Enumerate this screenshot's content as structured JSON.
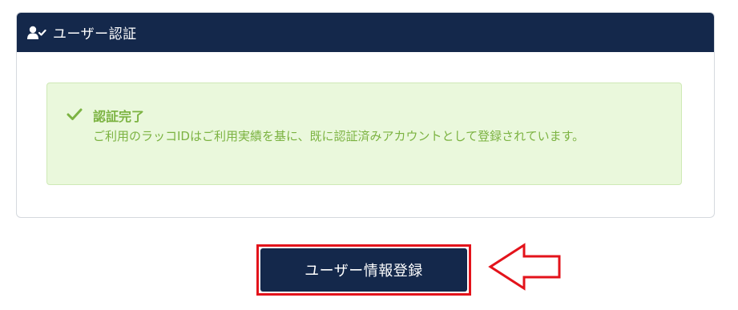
{
  "card": {
    "header_title": "ユーザー認証",
    "header_icon": "user-check-icon"
  },
  "alert": {
    "icon": "check-icon",
    "heading": "認証完了",
    "message": "ご利用のラッコIDはご利用実績を基に、既に認証済みアカウントとして登録されています。"
  },
  "actions": {
    "register_button_label": "ユーザー情報登録"
  },
  "annotation": {
    "arrow_icon": "left-arrow-icon",
    "highlight_color": "#e3131b"
  },
  "colors": {
    "header_bg": "#14284b",
    "alert_bg": "#eaf8dc",
    "alert_text": "#7cb342",
    "button_bg": "#14284b"
  }
}
